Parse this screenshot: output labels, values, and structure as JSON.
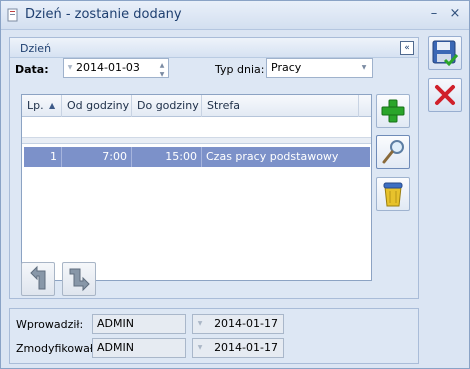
{
  "window": {
    "title": "Dzień - zostanie dodany",
    "minimize": "–",
    "close": "×"
  },
  "section": {
    "title": "Dzień",
    "collapse": "«"
  },
  "form": {
    "data_label": "Data:",
    "date_value": "2014-01-03",
    "typ_label": "Typ dnia:",
    "typ_value": "Pracy"
  },
  "table": {
    "columns": [
      "Lp.",
      "Od godziny",
      "Do godziny",
      "Strefa"
    ],
    "sort_indicator": "▲",
    "rows": [
      {
        "lp": "1",
        "od": "7:00",
        "do": "15:00",
        "strefa": "Czas pracy podstawowy"
      }
    ]
  },
  "footer": {
    "wprowadzil_label": "Wprowadził:",
    "wprowadzil_user": "ADMIN",
    "wprowadzil_date": "2014-01-17",
    "zmodyfikowal_label": "Zmodyfikował:",
    "zmodyfikowal_user": "ADMIN",
    "zmodyfikowal_date": "2014-01-17"
  },
  "icons": {
    "save": "floppy-disk-icon",
    "cancel": "red-x-icon",
    "add": "green-plus-icon",
    "edit": "magnifier-icon",
    "delete": "trash-bin-icon",
    "prev": "arrow-up-left-icon",
    "next": "arrow-down-right-icon"
  },
  "colors": {
    "accent": "#1e3f70",
    "selection": "#7c91c9",
    "add": "#2aa52a",
    "cancel": "#d0202a"
  }
}
